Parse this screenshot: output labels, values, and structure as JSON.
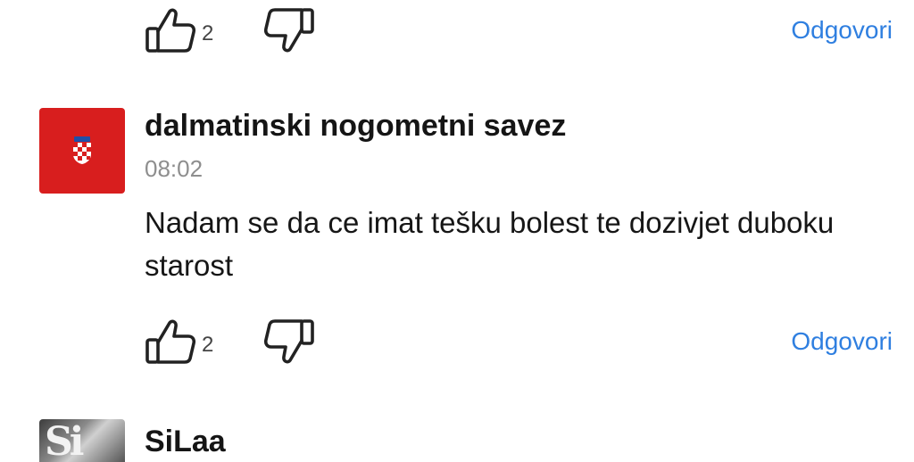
{
  "comments": [
    {
      "likes": "2",
      "reply_label": "Odgovori"
    },
    {
      "author": "dalmatinski nogometni savez",
      "time": "08:02",
      "text": "Nadam se da ce imat tešku bolest te dozivjet duboku starost",
      "likes": "2",
      "reply_label": "Odgovori",
      "avatar_color": "#d81e1e"
    },
    {
      "author": "SiLaa"
    }
  ],
  "colors": {
    "reply_link": "#2f7fe0",
    "timestamp": "#8e8e8e",
    "text": "#161616"
  },
  "icons": {
    "like": "thumbs-up-icon",
    "dislike": "thumbs-down-icon"
  }
}
